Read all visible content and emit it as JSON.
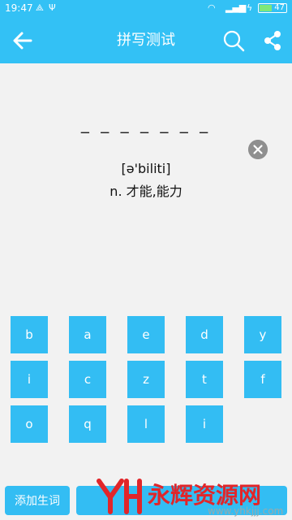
{
  "status_bar": {
    "time": "19:47",
    "battery_level": "47",
    "battery_fraction": 0.47
  },
  "toolbar": {
    "title": "拼写测试",
    "back_icon": "arrow-left-icon",
    "search_icon": "search-icon",
    "share_icon": "share-icon"
  },
  "quiz": {
    "blanks": "_ _ _ _ _ _ _",
    "phonetic": "[ə'biliti]",
    "meaning": "n. 才能,能力"
  },
  "keys": [
    "b",
    "a",
    "e",
    "d",
    "y",
    "i",
    "c",
    "z",
    "t",
    "f",
    "o",
    "q",
    "l",
    "i"
  ],
  "bottom": {
    "add_word_label": "添加生词"
  },
  "watermark": {
    "text": "永辉资源网",
    "url": "www.yhkjjj.com"
  },
  "colors": {
    "accent": "#33c1f5",
    "key": "#33bdf3"
  }
}
